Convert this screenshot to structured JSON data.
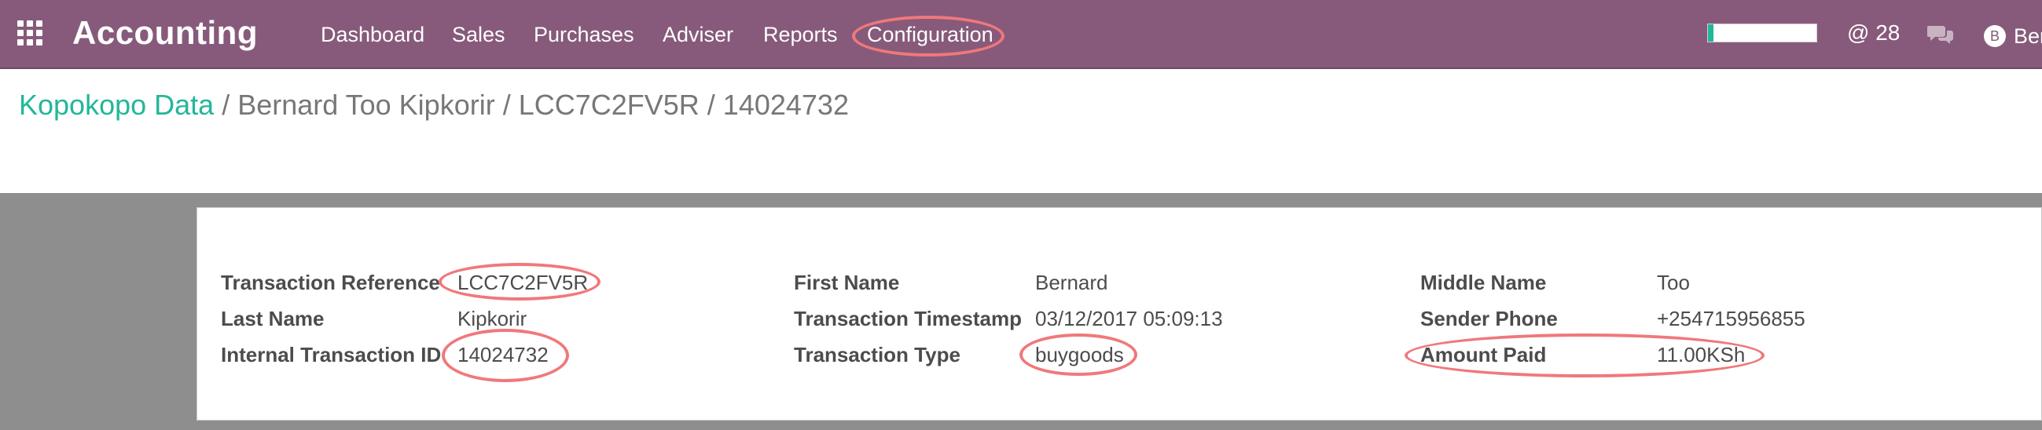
{
  "topbar": {
    "app_title": "Accounting",
    "apps_icon": "grid-icon",
    "menu": [
      {
        "label": "Dashboard"
      },
      {
        "label": "Sales"
      },
      {
        "label": "Purchases"
      },
      {
        "label": "Adviser"
      },
      {
        "label": "Reports"
      },
      {
        "label": "Configuration"
      }
    ],
    "progress_fraction": 0.05,
    "mentions_label": "@ 28",
    "chat_icon": "chat-bubbles-icon",
    "user_name": "Ber",
    "user_avatar": "B"
  },
  "breadcrumb": {
    "root": "Kopokopo Data",
    "separator": "/",
    "current": "Bernard Too Kipkorir / LCC7C2FV5R / 14024732"
  },
  "form": {
    "transaction_reference": {
      "label": "Transaction Reference",
      "value": "LCC7C2FV5R"
    },
    "last_name": {
      "label": "Last Name",
      "value": "Kipkorir"
    },
    "internal_transaction_id": {
      "label": "Internal Transaction ID",
      "value": "14024732"
    },
    "first_name": {
      "label": "First Name",
      "value": "Bernard"
    },
    "transaction_timestamp": {
      "label": "Transaction Timestamp",
      "value": "03/12/2017 05:09:13"
    },
    "transaction_type": {
      "label": "Transaction Type",
      "value": "buygoods"
    },
    "middle_name": {
      "label": "Middle Name",
      "value": "Too"
    },
    "sender_phone": {
      "label": "Sender Phone",
      "value": "+254715956855"
    },
    "amount_paid": {
      "label": "Amount Paid",
      "value": "11.00KSh"
    }
  },
  "colors": {
    "topbar": "#875a7b",
    "link": "#21b799",
    "highlight": "#f0787b",
    "backdrop": "#8e8e8e"
  }
}
